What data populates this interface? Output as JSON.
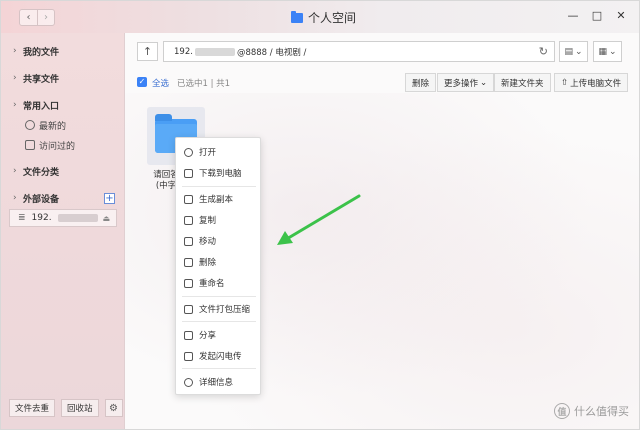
{
  "window": {
    "title": "个人空间",
    "nav_back": "‹",
    "nav_forward": "›",
    "minimize": "—",
    "maximize": "□",
    "close": "✕"
  },
  "sidebar": {
    "groups": [
      {
        "label": "我的文件"
      },
      {
        "label": "共享文件"
      },
      {
        "label": "常用入口"
      },
      {
        "label": "文件分类"
      },
      {
        "label": "外部设备"
      }
    ],
    "common_items": [
      {
        "label": "最新的"
      },
      {
        "label": "访问过的"
      }
    ],
    "device_label": "192.",
    "bottom": {
      "dedupe_label": "文件去重",
      "recycle_label": "回收站"
    }
  },
  "address": {
    "prefix": "192.",
    "suffix": "@8888 / 电视剧 /"
  },
  "toolbar": {
    "select_all": "全选",
    "selection_info": "已选中1 | 共1",
    "delete": "删除",
    "more_ops": "更多操作",
    "new_folder": "新建文件夹",
    "upload": "上传电脑文件"
  },
  "folder": {
    "name_line1": "请回答",
    "name_line2": "(中字"
  },
  "context_menu": {
    "items": [
      {
        "label": "打开"
      },
      {
        "label": "下载到电脑"
      },
      {
        "label": "生成副本"
      },
      {
        "label": "复制"
      },
      {
        "label": "移动"
      },
      {
        "label": "删除"
      },
      {
        "label": "重命名"
      },
      {
        "label": "文件打包压缩"
      },
      {
        "label": "分享"
      },
      {
        "label": "发起闪电传"
      },
      {
        "label": "详细信息"
      }
    ]
  },
  "watermark": {
    "logo": "值",
    "text": "什么值得买"
  },
  "colors": {
    "accent": "#3b82f6",
    "arrow": "#3cc24a",
    "sidebar_bg": "#efd9db"
  }
}
